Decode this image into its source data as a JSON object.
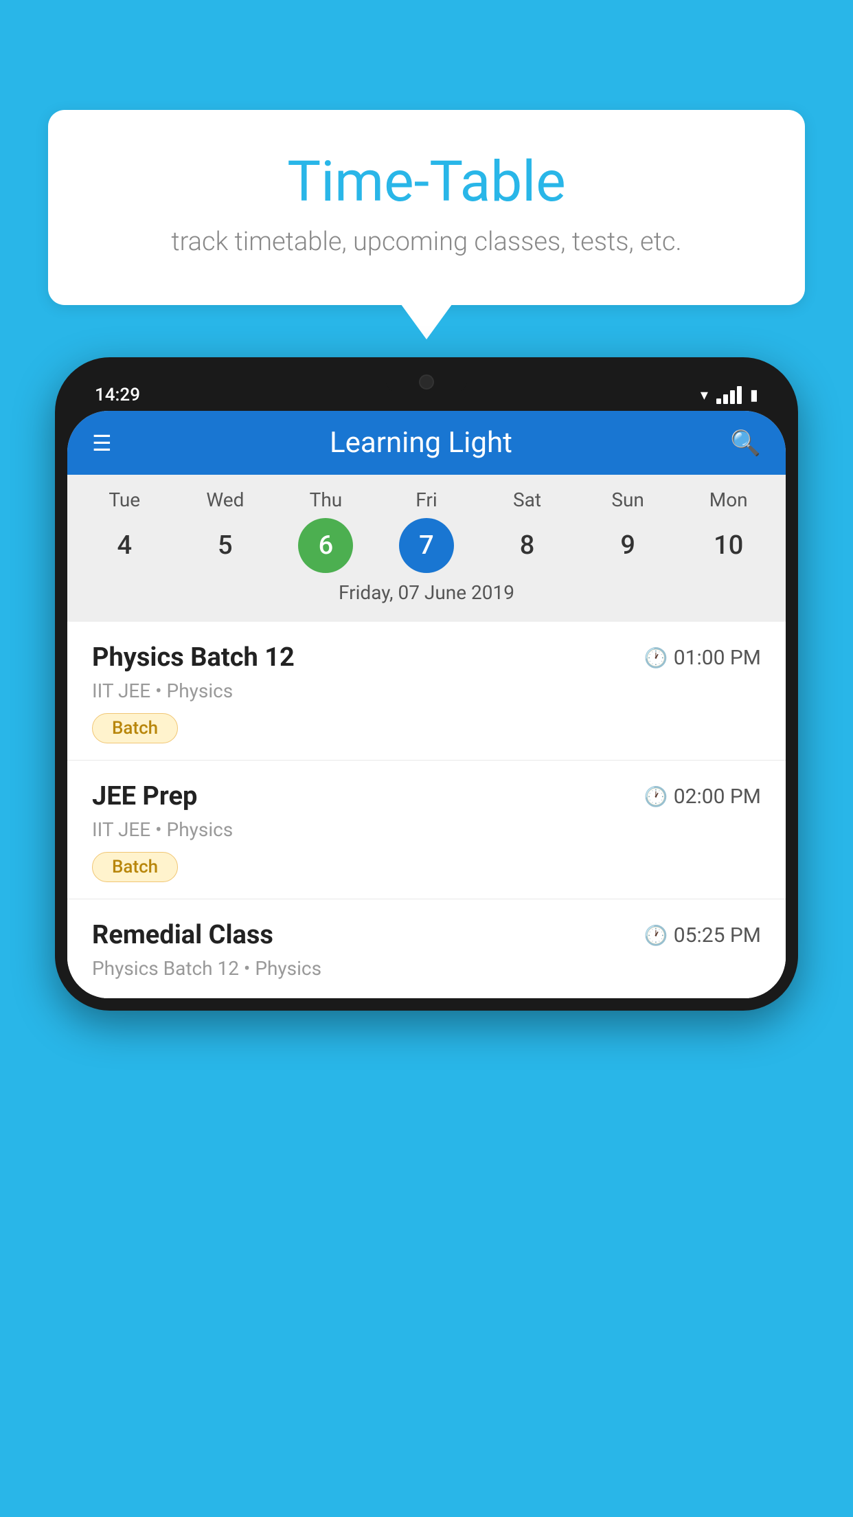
{
  "background_color": "#29B6E8",
  "bubble": {
    "title": "Time-Table",
    "subtitle": "track timetable, upcoming classes, tests, etc."
  },
  "phone": {
    "status_bar": {
      "time": "14:29"
    },
    "app_header": {
      "title": "Learning Light"
    },
    "calendar": {
      "days": [
        {
          "name": "Tue",
          "num": "4",
          "state": "normal"
        },
        {
          "name": "Wed",
          "num": "5",
          "state": "normal"
        },
        {
          "name": "Thu",
          "num": "6",
          "state": "today"
        },
        {
          "name": "Fri",
          "num": "7",
          "state": "selected"
        },
        {
          "name": "Sat",
          "num": "8",
          "state": "normal"
        },
        {
          "name": "Sun",
          "num": "9",
          "state": "normal"
        },
        {
          "name": "Mon",
          "num": "10",
          "state": "normal"
        }
      ],
      "selected_date_label": "Friday, 07 June 2019"
    },
    "schedule_items": [
      {
        "title": "Physics Batch 12",
        "time": "01:00 PM",
        "subject": "IIT JEE • Physics",
        "tag": "Batch"
      },
      {
        "title": "JEE Prep",
        "time": "02:00 PM",
        "subject": "IIT JEE • Physics",
        "tag": "Batch"
      },
      {
        "title": "Remedial Class",
        "time": "05:25 PM",
        "subject": "Physics Batch 12 • Physics",
        "tag": ""
      }
    ]
  }
}
